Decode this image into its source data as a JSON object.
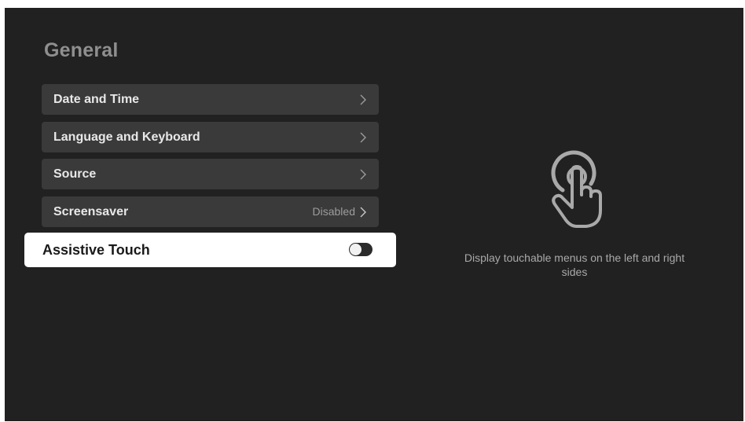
{
  "page": {
    "title": "General"
  },
  "menu": {
    "items": [
      {
        "label": "Date and Time",
        "value": ""
      },
      {
        "label": "Language and Keyboard",
        "value": ""
      },
      {
        "label": "Source",
        "value": ""
      },
      {
        "label": "Screensaver",
        "value": "Disabled"
      },
      {
        "label": "Assistive Touch",
        "value": "",
        "toggle_state": "off",
        "focused": true
      }
    ]
  },
  "detail": {
    "icon": "touch-hand-icon",
    "description": "Display touchable menus on the left and right sides"
  },
  "colors": {
    "background": "#212121",
    "item_background": "#3a3a3a",
    "focused_background": "#ffffff"
  }
}
